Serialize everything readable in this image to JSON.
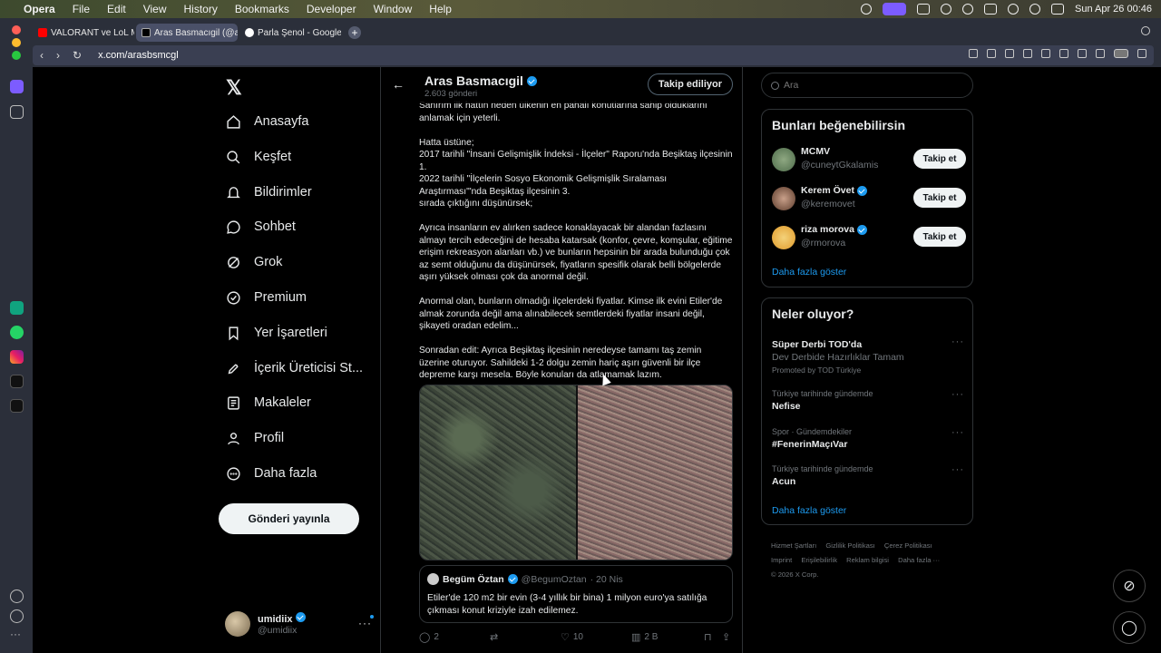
{
  "menubar": {
    "app": "Opera",
    "menus": [
      "File",
      "Edit",
      "View",
      "History",
      "Bookmarks",
      "Developer",
      "Window",
      "Help"
    ],
    "datetime": "Sun Apr 26  00:46"
  },
  "browser": {
    "tabs": [
      {
        "label": "VALORANT ve LoL Milli T",
        "color": "#ff0000"
      },
      {
        "label": "Aras Basmacıgil (@arasb",
        "color": "#000000"
      },
      {
        "label": "Parla Şenol - Google'da",
        "color": "#4285f4"
      }
    ],
    "url": "x.com/arasbsmcgl"
  },
  "nav": {
    "items": [
      {
        "label": "Anasayfa",
        "icon": "home-icon"
      },
      {
        "label": "Keşfet",
        "icon": "search-icon"
      },
      {
        "label": "Bildirimler",
        "icon": "bell-icon"
      },
      {
        "label": "Sohbet",
        "icon": "chat-icon"
      },
      {
        "label": "Grok",
        "icon": "grok-icon"
      },
      {
        "label": "Premium",
        "icon": "premium-icon"
      },
      {
        "label": "Yer İşaretleri",
        "icon": "bookmark-icon"
      },
      {
        "label": "İçerik Üreticisi St...",
        "icon": "rocket-icon"
      },
      {
        "label": "Makaleler",
        "icon": "article-icon"
      },
      {
        "label": "Profil",
        "icon": "profile-icon"
      },
      {
        "label": "Daha fazla",
        "icon": "more-icon"
      }
    ],
    "post_button": "Gönderi yayınla",
    "account": {
      "name": "umidiix",
      "handle": "@umidiix"
    }
  },
  "profile": {
    "name": "Aras Basmacıgil",
    "posts_count": "2.603 gönderi",
    "follow_state": "Takip ediliyor"
  },
  "tweet": {
    "text": "Sanırım ilk hattın neden ülkenin en pahalı konutlarına sahip olduklarını anlamak için yeterli.\n\nHatta üstüne;\n2017 tarihli \"İnsani Gelişmişlik İndeksi - İlçeler\" Raporu'nda Beşiktaş ilçesinin 1.\n2022 tarihli \"İlçelerin Sosyo Ekonomik Gelişmişlik Sıralaması Araştırması\"'nda Beşiktaş ilçesinin 3.\nsırada çıktığını düşünürsek;\n\nAyrıca insanların ev alırken sadece konaklayacak bir alandan fazlasını almayı tercih edeceğini de hesaba katarsak (konfor, çevre, komşular, eğitime erişim rekreasyon alanları vb.) ve bunların hepsinin bir arada bulunduğu çok az semt olduğunu da düşünürsek, fiyatların spesifik olarak belli bölgelerde aşırı yüksek olması çok da anormal değil.\n\nAnormal olan, bunların olmadığı ilçelerdeki fiyatlar. Kimse ilk evini Etiler'de almak zorunda değil ama alınabilecek semtlerdeki fiyatlar insani değil, şikayeti oradan edelim...\n\nSonradan edit: Ayrıca Beşiktaş ilçesinin neredeyse tamamı taş zemin üzerine oturuyor. Sahildeki 1-2 dolgu zemin hariç aşırı güvenli bir ilçe depreme karşı mesela. Böyle konuları da atlamamak lazım.",
    "quote": {
      "name": "Begüm Öztan",
      "handle": "@BegumOztan",
      "date": "· 20 Nis",
      "text": "Etiler'de 120 m2 bir evin (3-4 yıllık bir bina) 1 milyon euro'ya satılığa çıkması konut kriziyle izah edilemez."
    },
    "stats": {
      "replies": "2",
      "likes": "10",
      "views": "2 B"
    }
  },
  "right": {
    "search_placeholder": "Ara",
    "suggestions_title": "Bunları beğenebilirsin",
    "suggestions": [
      {
        "name": "MCMV",
        "handle": "@cuneytGkalamis",
        "verified": false,
        "button": "Takip et"
      },
      {
        "name": "Kerem Övet",
        "handle": "@keremovet",
        "verified": true,
        "button": "Takip et"
      },
      {
        "name": "riza morova",
        "handle": "@rmorova",
        "verified": true,
        "button": "Takip et"
      }
    ],
    "show_more": "Daha fazla göster",
    "trends_title": "Neler oluyor?",
    "trends": [
      {
        "context": "",
        "name": "Süper Derbi TOD'da",
        "sub": "Dev Derbide Hazırlıklar Tamam",
        "promo": "Promoted by TOD Türkiye"
      },
      {
        "context": "Türkiye tarihinde gündemde",
        "name": "Nefise",
        "sub": "",
        "promo": ""
      },
      {
        "context": "Spor · Gündemdekiler",
        "name": "#FenerinMaçıVar",
        "sub": "",
        "promo": ""
      },
      {
        "context": "Türkiye tarihinde gündemde",
        "name": "Acun",
        "sub": "",
        "promo": ""
      }
    ],
    "trends_more": "Daha fazla göster",
    "footer": [
      "Hizmet Şartları",
      "Gizlilik Politikası",
      "Çerez Politikası",
      "Imprint",
      "Erişilebilirlik",
      "Reklam bilgisi",
      "Daha fazla ···",
      "© 2026 X Corp."
    ]
  }
}
